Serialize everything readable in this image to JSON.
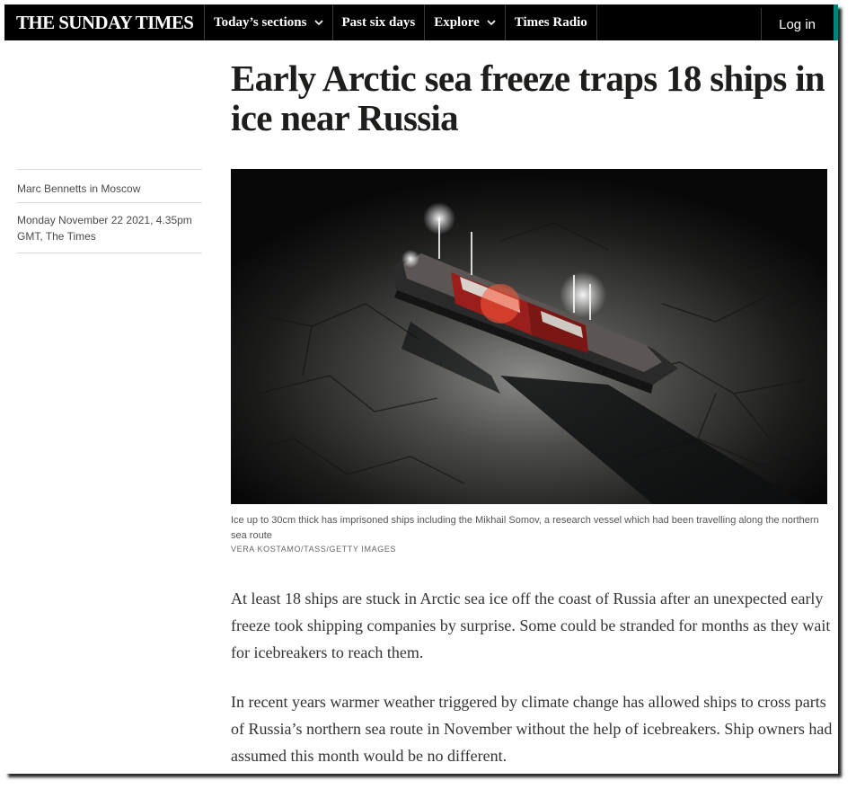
{
  "nav": {
    "logo": "THE SUNDAY TIMES",
    "items": [
      {
        "label": "Today’s sections",
        "dropdown": true
      },
      {
        "label": "Past six days",
        "dropdown": false
      },
      {
        "label": "Explore",
        "dropdown": true
      },
      {
        "label": "Times Radio",
        "dropdown": false
      }
    ],
    "login": "Log in",
    "accent_color": "#00827c"
  },
  "article": {
    "headline": "Early Arctic sea freeze traps 18 ships in ice near Russia",
    "author": "Marc Bennetts in Moscow",
    "date": "Monday November 22 2021, 4.35pm GMT, The Times",
    "image": {
      "description_icon": "ship-in-ice-photo",
      "caption": "Ice up to 30cm thick has imprisoned ships including the Mikhail Somov, a research vessel which had been travelling along the northern sea route",
      "credit": "VERA KOSTAMO/TASS/GETTY IMAGES"
    },
    "paragraphs": [
      "At least 18 ships are stuck in Arctic sea ice off the coast of Russia after an unexpected early freeze took shipping companies by surprise. Some could be stranded for months as they wait for icebreakers to reach them.",
      "In recent years warmer weather triggered by climate change has allowed ships to cross parts of Russia’s northern sea route in November without the help of icebreakers. Ship owners had assumed this month would be no different."
    ]
  }
}
